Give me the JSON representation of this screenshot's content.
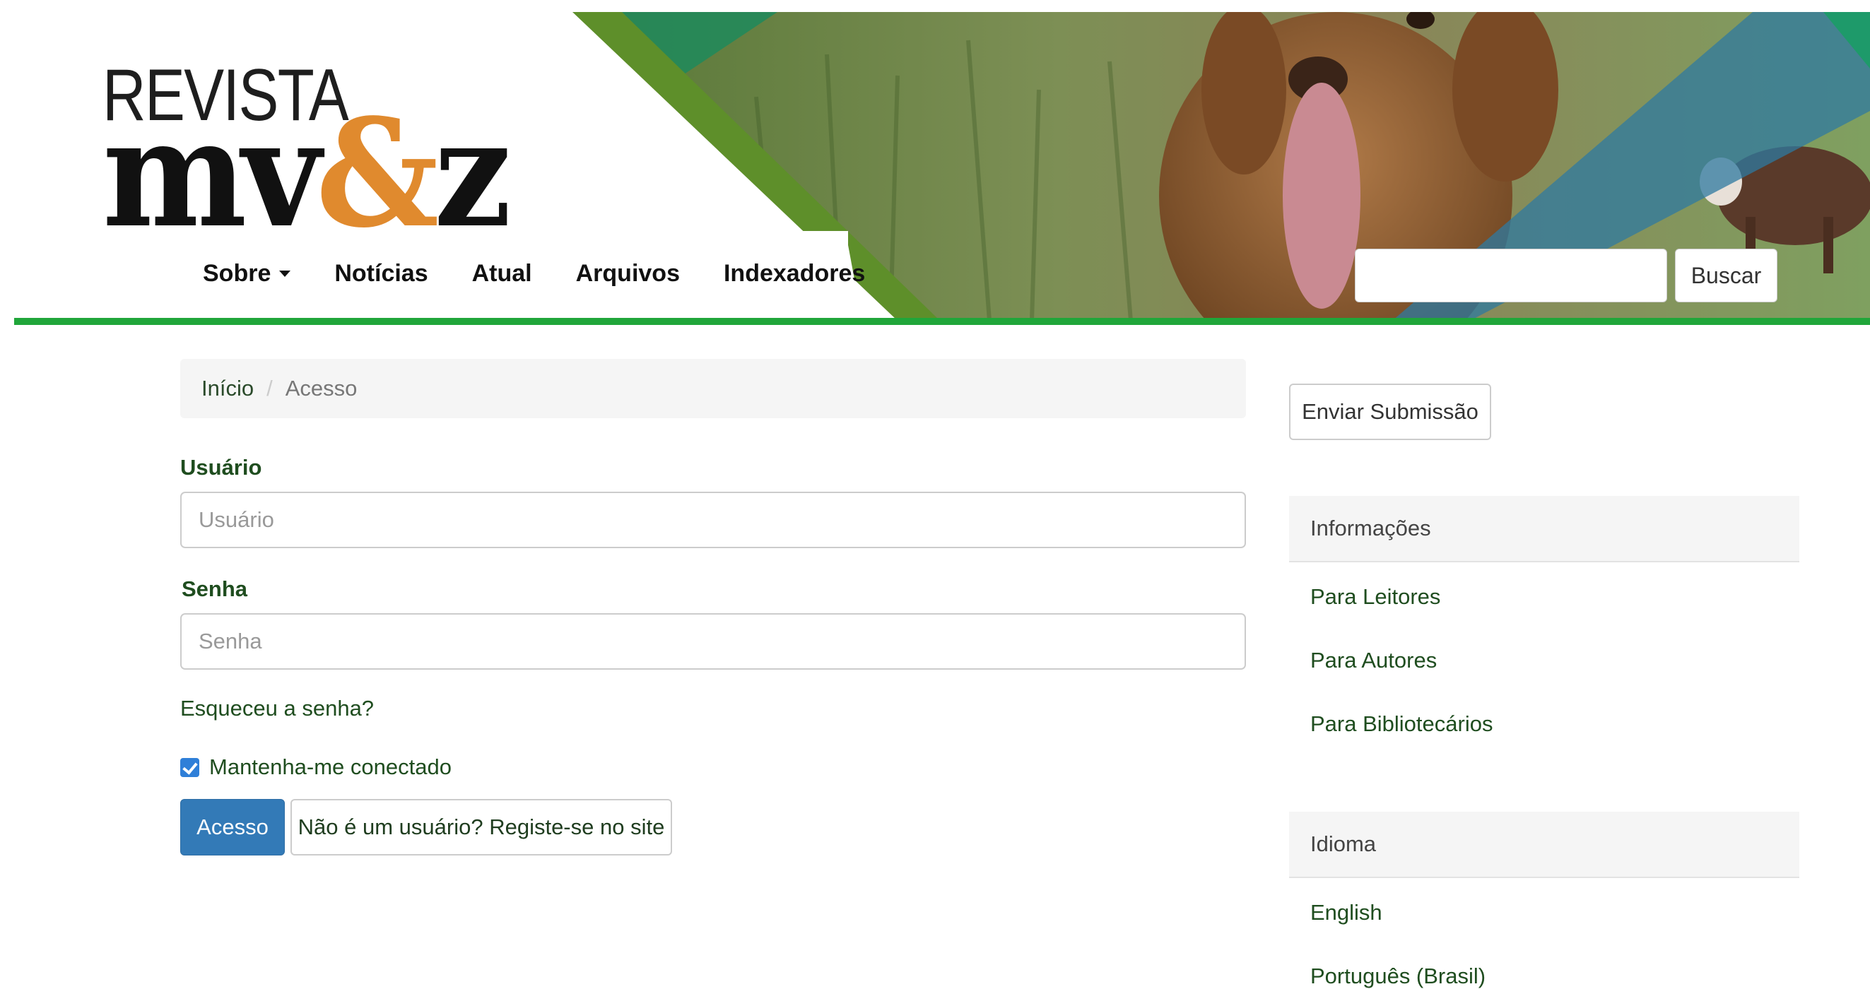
{
  "header": {
    "logo_top": "REVISTA",
    "logo_mv": "mv",
    "logo_amp": "&",
    "logo_z": "z",
    "nav": [
      {
        "label": "Sobre",
        "dropdown": true
      },
      {
        "label": "Notícias"
      },
      {
        "label": "Atual"
      },
      {
        "label": "Arquivos"
      },
      {
        "label": "Indexadores"
      }
    ],
    "search_value": "",
    "search_button": "Buscar",
    "accent_green": "#20a63a",
    "logo_orange": "#e08a2e"
  },
  "breadcrumb": {
    "home": "Início",
    "separator": "/",
    "current": "Acesso"
  },
  "login_form": {
    "username_label": "Usuário",
    "username_placeholder": "Usuário",
    "password_label": "Senha",
    "password_placeholder": "Senha",
    "forgot_link": "Esqueceu a senha?",
    "remember_label": "Mantenha-me conectado",
    "remember_checked": true,
    "submit_button": "Acesso",
    "register_button": "Não é um usuário? Registe-se no site",
    "primary_color": "#337ab7"
  },
  "sidebar": {
    "submission_button": "Enviar Submissão",
    "info_title": "Informações",
    "info_links": [
      "Para Leitores",
      "Para Autores",
      "Para Bibliotecários"
    ],
    "language_title": "Idioma",
    "languages": [
      "English",
      "Português (Brasil)"
    ]
  }
}
